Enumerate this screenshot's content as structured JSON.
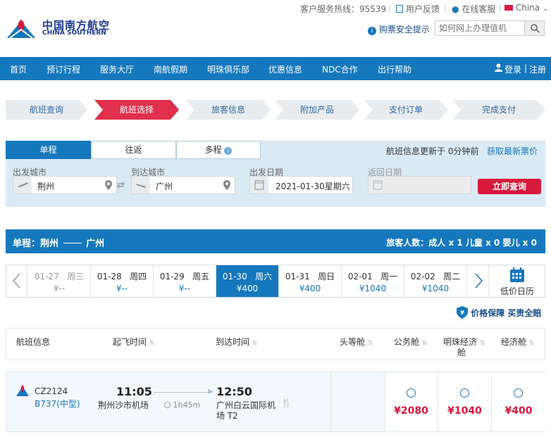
{
  "topbar": {
    "hotline": "客户服务热线：95539",
    "feedback": "用户反馈",
    "online_service": "在线客服",
    "region": "China"
  },
  "brand": {
    "name_cn": "中国南方航空",
    "name_en": "CHINA SOUTHERN"
  },
  "header": {
    "safety_tip": "购票安全提示",
    "search_placeholder": "如何网上办理值机"
  },
  "nav": {
    "items": [
      "首页",
      "预订行程",
      "服务大厅",
      "南航假期",
      "明珠俱乐部",
      "优惠信息",
      "NDC合作",
      "出行帮助"
    ],
    "login": "登录",
    "separator": "|",
    "register": "注册"
  },
  "steps": [
    "航班查询",
    "航班选择",
    "旅客信息",
    "附加产品",
    "支付订单",
    "完成支付"
  ],
  "active_step": 1,
  "search": {
    "tabs": [
      "单程",
      "往返",
      "多程"
    ],
    "active_tab": 0,
    "updated_text": "航班信息更新于",
    "updated_value": "0分钟前",
    "refresh_link": "获取最新票价",
    "depart_city_label": "出发城市",
    "depart_city": "荆州",
    "arrive_city_label": "到达城市",
    "arrive_city": "广州",
    "depart_date_label": "出发日期",
    "depart_date": "2021-01-30星期六",
    "return_date_label": "返回日期",
    "return_date": "",
    "search_button": "立即查询"
  },
  "route": {
    "label": "单程：荆州",
    "destination": "广州",
    "passengers": "旅客人数：成人 x 1 儿童 x 0 婴儿 x 0"
  },
  "dates": [
    {
      "date": "01-27",
      "weekday": "周三",
      "price": "¥--",
      "state": "dim"
    },
    {
      "date": "01-28",
      "weekday": "周四",
      "price": "¥--",
      "state": "normal"
    },
    {
      "date": "01-29",
      "weekday": "周五",
      "price": "¥--",
      "state": "normal"
    },
    {
      "date": "01-30",
      "weekday": "周六",
      "price": "¥400",
      "state": "selected"
    },
    {
      "date": "01-31",
      "weekday": "周日",
      "price": "¥400",
      "state": "normal"
    },
    {
      "date": "02-01",
      "weekday": "周一",
      "price": "¥1040",
      "state": "normal"
    },
    {
      "date": "02-02",
      "weekday": "周二",
      "price": "¥1040",
      "state": "normal"
    }
  ],
  "calendar_label": "低价日历",
  "guarantee": {
    "price": "价格保障",
    "buy": "买贵全赔"
  },
  "table_headers": {
    "flight": "航班信息",
    "depart": "起飞时间",
    "arrive": "到达时间",
    "first": "头等舱",
    "business": "公务舱",
    "pearl_line1": "明珠经济",
    "pearl_line2": "舱",
    "economy": "经济舱"
  },
  "flight": {
    "number": "CZ2124",
    "aircraft": "B737(中型)",
    "depart_time": "11:05",
    "depart_airport": "荆州沙市机场",
    "duration": "1h45m",
    "arrive_time": "12:50",
    "arrive_airport_line1": "广州白云国际机",
    "arrive_airport_line2": "场 T2",
    "fares": [
      "¥2080",
      "¥1040",
      "¥400"
    ]
  },
  "colors": {
    "brand_blue": "#1578bd",
    "accent_red": "#d7193c",
    "step_active": "#e0304c"
  }
}
